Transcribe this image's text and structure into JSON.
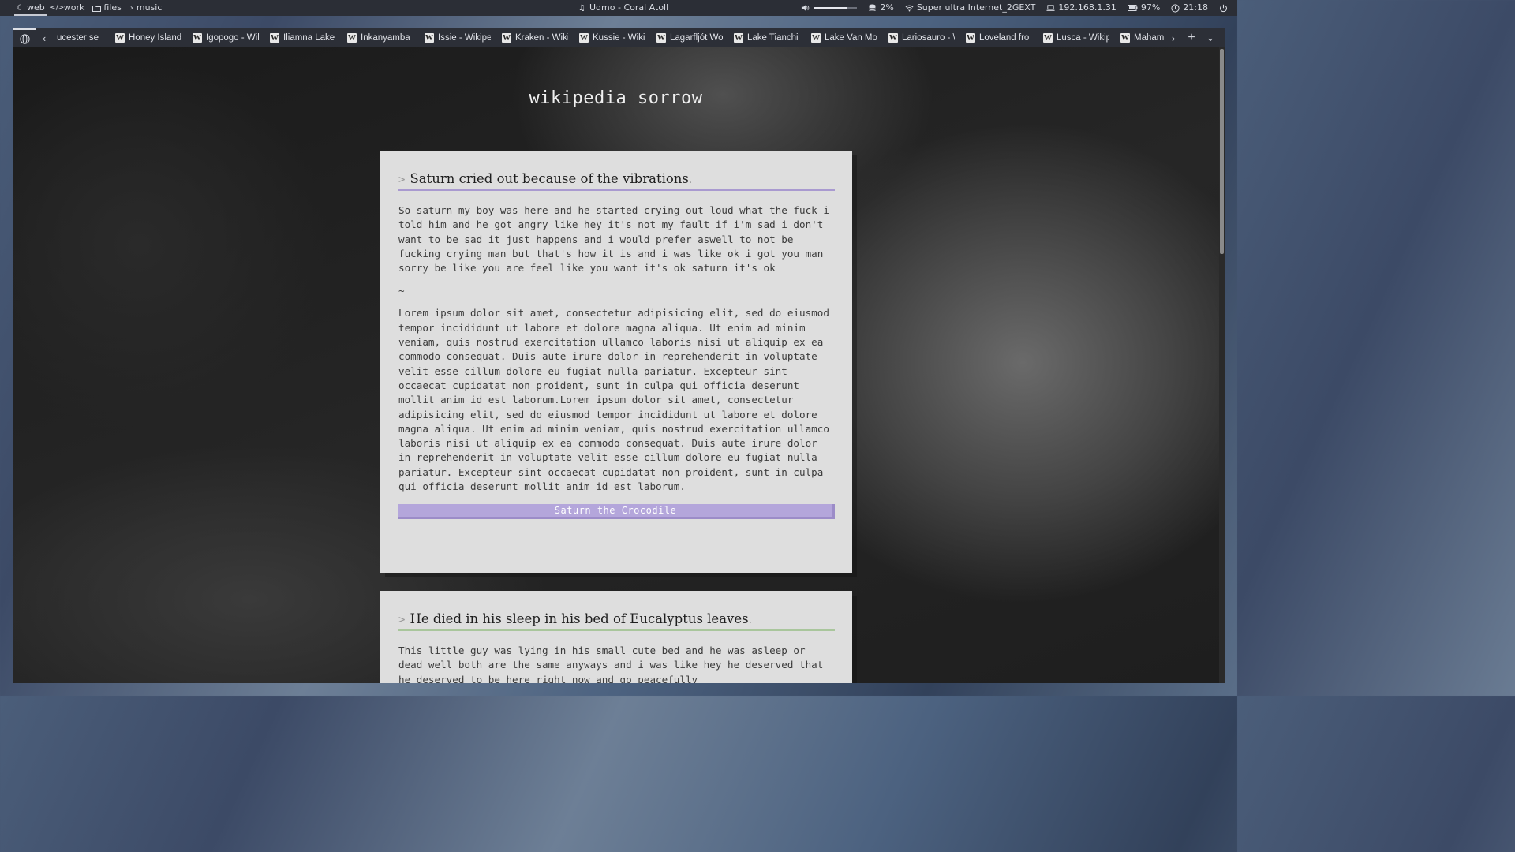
{
  "topbar": {
    "workspaces": [
      {
        "icon": "moon-icon",
        "label": "web"
      },
      {
        "icon": "code-icon",
        "label": "work"
      },
      {
        "icon": "folder-icon",
        "label": "files"
      },
      {
        "icon": "chevron-right-icon",
        "label": "music"
      }
    ],
    "now_playing": "Udmo - Coral Atoll",
    "volume_level": 0.75,
    "disk": "2%",
    "wifi": "Super ultra Internet_2GEXT",
    "ip": "192.168.1.31",
    "battery": "97%",
    "clock": "21:18"
  },
  "browser": {
    "tabs": [
      {
        "label": "ucester se"
      },
      {
        "label": "Honey Island"
      },
      {
        "label": "Igopogo - Wil"
      },
      {
        "label": "Iliamna Lake"
      },
      {
        "label": "Inkanyamba"
      },
      {
        "label": "Issie - Wikipe"
      },
      {
        "label": "Kraken - Wiki"
      },
      {
        "label": "Kussie - Wikip"
      },
      {
        "label": "Lagarfljót Wo"
      },
      {
        "label": "Lake Tianchi I"
      },
      {
        "label": "Lake Van Mo"
      },
      {
        "label": "Lariosauro - \\"
      },
      {
        "label": "Loveland fro"
      },
      {
        "label": "Lusca - Wikipe"
      },
      {
        "label": "Mahamba - \\"
      }
    ]
  },
  "page": {
    "site_title": "wikipedia sorrow",
    "cards": [
      {
        "caret": ">",
        "title": "Saturn cried out because of the vibrations",
        "title_dot": ".",
        "body1": "So saturn my boy was here and he started crying out loud what the fuck i told him and he got angry like hey it's not my fault if i'm sad i don't want to be sad it just happens and i would prefer aswell to not be fucking crying man but that's how it is and i was like ok i got you man sorry be like you are feel like you want it's ok saturn it's ok",
        "separator": "~",
        "body2": "Lorem ipsum dolor sit amet, consectetur adipisicing elit, sed do eiusmod tempor incididunt ut labore et dolore magna aliqua. Ut enim ad minim veniam, quis nostrud exercitation ullamco laboris nisi ut aliquip ex ea commodo consequat. Duis aute irure dolor in reprehenderit in voluptate velit esse cillum dolore eu fugiat nulla pariatur. Excepteur sint occaecat cupidatat non proident, sunt in culpa qui officia deserunt mollit anim id est laborum.Lorem ipsum dolor sit amet, consectetur adipisicing elit, sed do eiusmod tempor incididunt ut labore et dolore magna aliqua. Ut enim ad minim veniam, quis nostrud exercitation ullamco laboris nisi ut aliquip ex ea commodo consequat. Duis aute irure dolor in reprehenderit in voluptate velit esse cillum dolore eu fugiat nulla pariatur. Excepteur sint occaecat cupidatat non proident, sunt in culpa qui officia deserunt mollit anim id est laborum.",
        "button": "Saturn the Crocodile",
        "accent": "#a99ad0"
      },
      {
        "caret": ">",
        "title": "He died in his sleep in his bed of Eucalyptus leaves",
        "title_dot": ".",
        "body1": "This little guy was lying in his small cute bed and he was asleep or dead well both are the same anyways and i was like hey he deserved that he deserved to be here right now and go peacefully",
        "accent": "#a9c69c"
      }
    ]
  }
}
